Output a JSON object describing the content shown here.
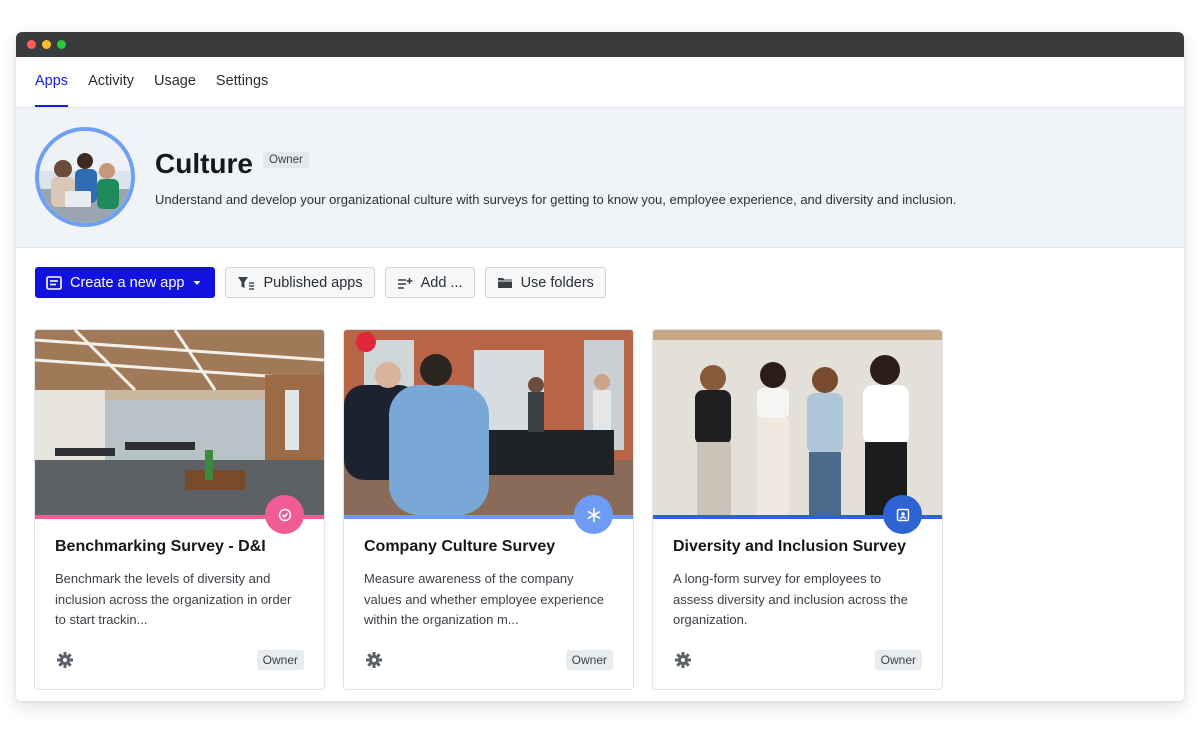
{
  "window": {
    "controls": [
      "close",
      "minimize",
      "maximize"
    ]
  },
  "nav": {
    "tabs": [
      {
        "label": "Apps",
        "active": true
      },
      {
        "label": "Activity",
        "active": false
      },
      {
        "label": "Usage",
        "active": false
      },
      {
        "label": "Settings",
        "active": false
      }
    ]
  },
  "hero": {
    "title": "Culture",
    "role_badge": "Owner",
    "description": "Understand and develop your organizational culture with surveys for getting to know you, employee experience, and diversity and inclusion."
  },
  "toolbar": {
    "create_label": "Create a new app",
    "published_label": "Published apps",
    "add_label": "Add ...",
    "folders_label": "Use folders"
  },
  "cards": [
    {
      "title": "Benchmarking Survey - D&I",
      "description": "Benchmark the levels of diversity and inclusion across the organization in order to start trackin...",
      "owner": "Owner",
      "accent": "#f25c94",
      "icon": "check-badge-icon"
    },
    {
      "title": "Company Culture Survey",
      "description": "Measure awareness of the company values and whether employee experience within the organization m...",
      "owner": "Owner",
      "accent": "#6e9cf5",
      "icon": "asterisk-icon"
    },
    {
      "title": "Diversity and Inclusion Survey",
      "description": "A long-form survey for employees to assess diversity and inclusion across the organization.",
      "owner": "Owner",
      "accent": "#2e63d4",
      "icon": "contact-card-icon"
    }
  ],
  "colors": {
    "primary": "#1212e0",
    "active_tab": "#1a1adb",
    "hero_bg": "#f0f4f8",
    "avatar_ring": "#6d9ff4"
  }
}
